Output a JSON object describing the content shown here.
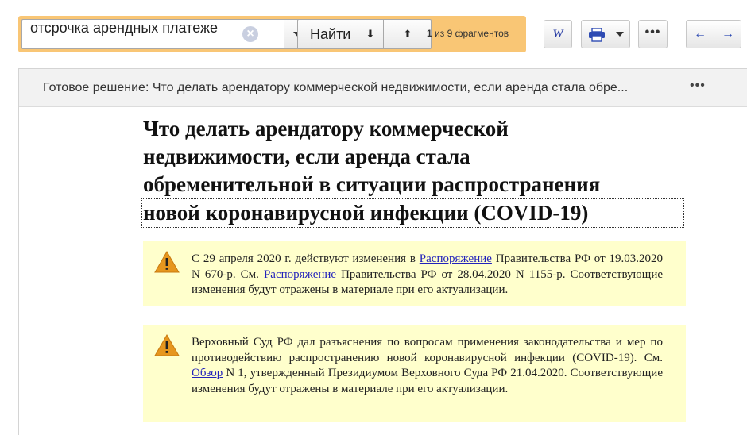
{
  "search": {
    "query": "отсрочка арендных платеже",
    "find_label": "Найти",
    "down_arrow": "⬇",
    "up_arrow": "⬆",
    "hits_current": "1",
    "hits_rest": "из 9 фрагментов"
  },
  "toolbar": {
    "word_label": "W",
    "more_label": "•••",
    "nav_back": "←",
    "nav_forward": "→"
  },
  "doc_header": {
    "title": "Готовое решение: Что делать арендатору коммерческой недвижимости, если аренда стала обре...",
    "more": "•••"
  },
  "document": {
    "title_lines": [
      "Что делать арендатору коммерческой",
      "недвижимости, если аренда стала",
      "обременительной в ситуации распространения",
      "новой коронавирусной инфекции (COVID-19)"
    ],
    "notices": [
      {
        "t1": "С 29 апреля 2020 г. действуют изменения в ",
        "link1": "Распоряжение",
        "t2": " Правительства РФ от 19.03.2020 N 670-р. См. ",
        "link2": "Распоряжение",
        "t3": " Правительства РФ от 28.04.2020 N 1155-р. Соответствующие изменения будут отражены в материале при его актуализации."
      },
      {
        "t1": "Верховный Суд РФ дал разъяснения по вопросам применения законодательства и мер по противодействию распространению новой коронавирусной инфекции (COVID-19). См. ",
        "link1": "Обзор",
        "t2": " N 1, утвержденный Президиумом Верховного Суда РФ 21.04.2020. Соответствующие изменения будут отражены в материале при его актуализации."
      }
    ]
  },
  "colors": {
    "search_highlight": "#f9c675",
    "notice_background": "#ffffcc",
    "link": "#2222bb",
    "nav_arrow": "#2e4bb3",
    "warning": "#e6961e"
  }
}
